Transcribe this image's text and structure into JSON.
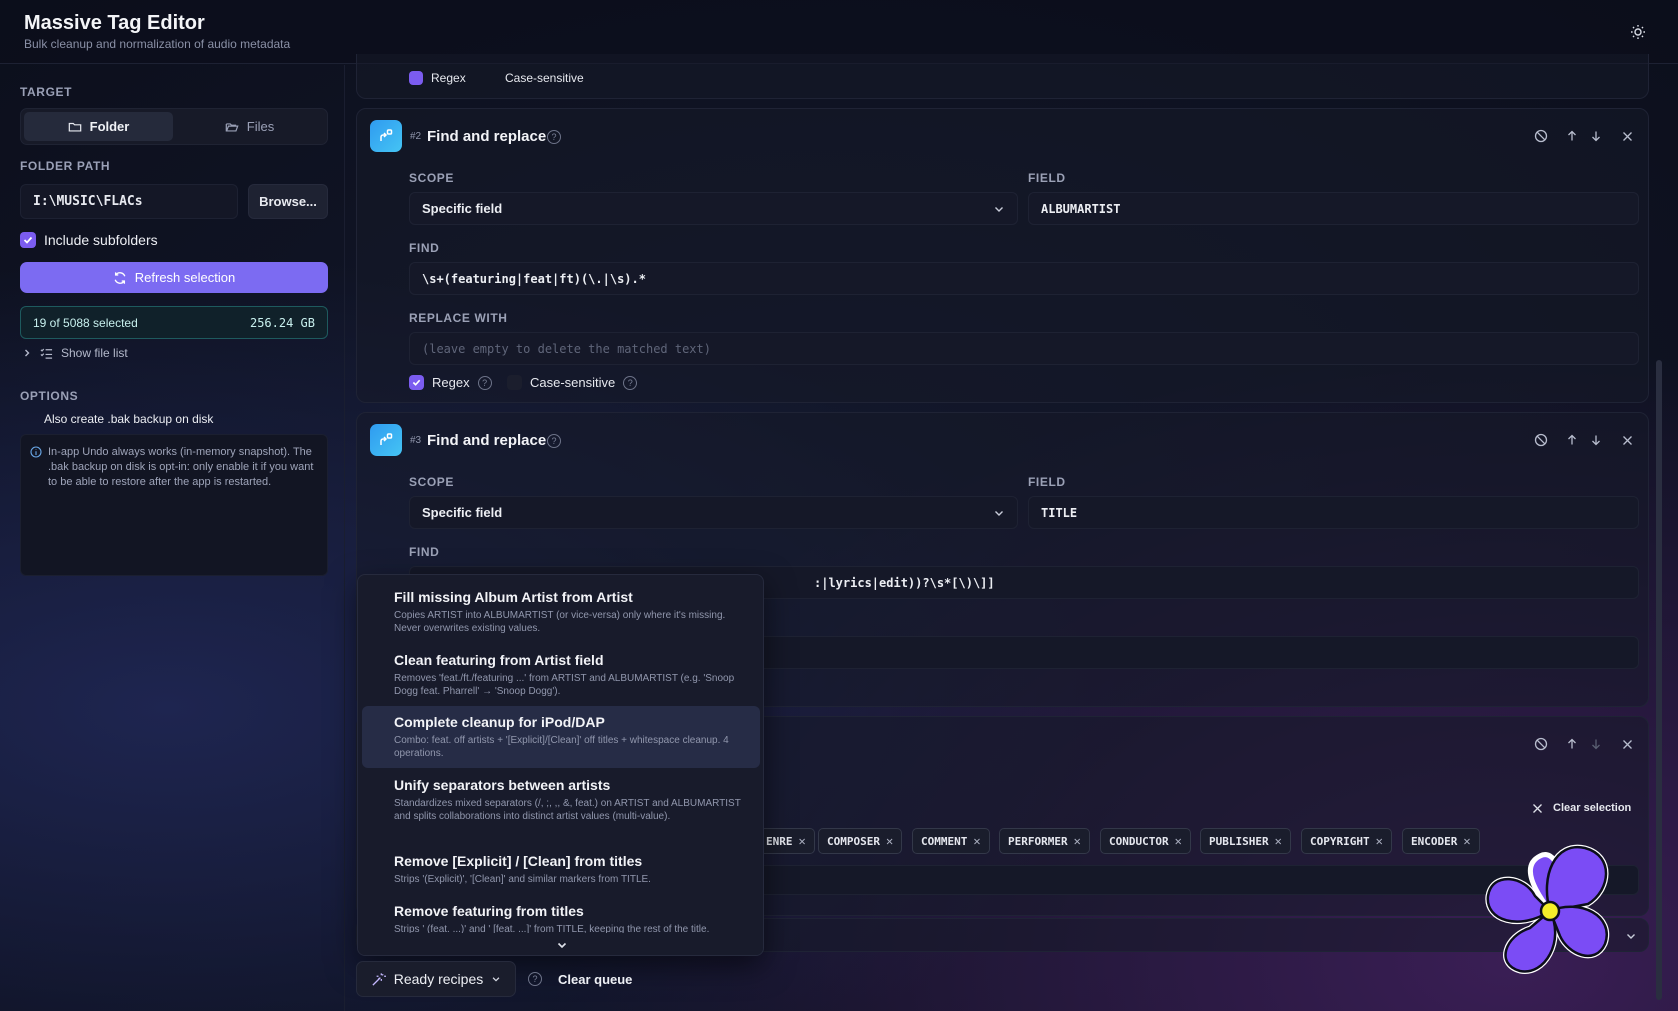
{
  "app": {
    "title": "Massive Tag Editor",
    "subtitle": "Bulk cleanup and normalization of audio metadata"
  },
  "sidebar": {
    "target_label": "TARGET",
    "folder_btn": "Folder",
    "files_btn": "Files",
    "path_label": "FOLDER PATH",
    "path_value": "I:\\MUSIC\\FLACs",
    "browse": "Browse...",
    "include_subfolders": "Include subfolders",
    "refresh": "Refresh selection",
    "selected_text": "19 of 5088 selected",
    "selected_size": "256.24 GB",
    "show_file_list": "Show file list",
    "options_label": "OPTIONS",
    "bak_option": "Also create .bak backup on disk",
    "info_text": "In-app Undo always works (in-memory snapshot). The .bak backup on disk is opt-in: only enable it if you want to be able to restore after the app is restarted."
  },
  "prev_card": {
    "regex": "Regex",
    "case": "Case-sensitive"
  },
  "op2": {
    "num": "#2",
    "title": "Find and replace",
    "scope_label": "SCOPE",
    "scope_value": "Specific field",
    "field_label": "FIELD",
    "field_value": "ALBUMARTIST",
    "find_label": "FIND",
    "find_value": "\\s+(featuring|feat|ft)(\\.|\\s).*",
    "replace_label": "REPLACE WITH",
    "replace_placeholder": "(leave empty to delete the matched text)",
    "regex": "Regex",
    "case": "Case-sensitive"
  },
  "op3": {
    "num": "#3",
    "title": "Find and replace",
    "scope_label": "SCOPE",
    "scope_value": "Specific field",
    "field_label": "FIELD",
    "field_value": "TITLE",
    "find_label": "FIND",
    "find_value_visible": ":|lyrics|edit))?\\s*[\\)\\]]"
  },
  "op4": {
    "clear_selection": "Clear selection",
    "tags": [
      "ENRE",
      "COMPOSER",
      "COMMENT",
      "PERFORMER",
      "CONDUCTOR",
      "PUBLISHER",
      "COPYRIGHT",
      "ENCODER"
    ]
  },
  "recipes": [
    {
      "title": "Fill missing Album Artist from Artist",
      "desc": "Copies ARTIST into ALBUMARTIST (or vice-versa) only where it's missing. Never overwrites existing values."
    },
    {
      "title": "Clean featuring from Artist field",
      "desc": "Removes 'feat./ft./featuring ...' from ARTIST and ALBUMARTIST (e.g. 'Snoop Dogg feat. Pharrell' → 'Snoop Dogg')."
    },
    {
      "title": "Complete cleanup for iPod/DAP",
      "desc": "Combo: feat. off artists + '[Explicit]/[Clean]' off titles + whitespace cleanup. 4 operations."
    },
    {
      "title": "Unify separators between artists",
      "desc": "Standardizes mixed separators (/, ;, ,, &, feat.) on ARTIST and ALBUMARTIST and splits collaborations into distinct artist values (multi-value)."
    },
    {
      "title": "Remove [Explicit] / [Clean] from titles",
      "desc": "Strips '(Explicit)', '[Clean]' and similar markers from TITLE."
    },
    {
      "title": "Remove featuring from titles",
      "desc": "Strips ' (feat. ...)' and ' [feat. ...]' from TITLE, keeping the rest of the title."
    }
  ],
  "bottom": {
    "ready_recipes": "Ready recipes",
    "clear_queue": "Clear queue"
  },
  "colors": {
    "accent": "#7c6bf2",
    "op_icon": "#3aaef2",
    "mascot": "#7b4cf5"
  }
}
